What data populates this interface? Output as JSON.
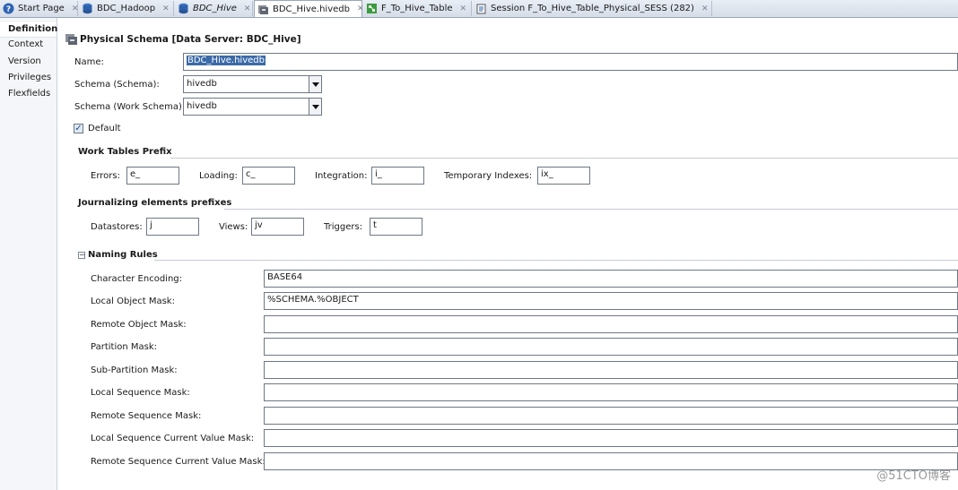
{
  "tabs": [
    {
      "label": "Start Page",
      "icon": "help-icon",
      "italic": false,
      "active": false
    },
    {
      "label": "BDC_Hadoop",
      "icon": "database-icon",
      "italic": false,
      "active": false
    },
    {
      "label": "BDC_Hive",
      "icon": "database-icon",
      "italic": true,
      "active": false
    },
    {
      "label": "BDC_Hive.hivedb",
      "icon": "physical-schema-icon",
      "italic": false,
      "active": true
    },
    {
      "label": "F_To_Hive_Table",
      "icon": "mapping-icon",
      "italic": false,
      "active": false
    },
    {
      "label": "Session F_To_Hive_Table_Physical_SESS (282)",
      "icon": "session-icon",
      "italic": false,
      "active": false
    }
  ],
  "nav": [
    {
      "label": "Definition",
      "selected": true
    },
    {
      "label": "Context",
      "selected": false
    },
    {
      "label": "Version",
      "selected": false
    },
    {
      "label": "Privileges",
      "selected": false
    },
    {
      "label": "Flexfields",
      "selected": false
    }
  ],
  "header": {
    "title": "Physical Schema [Data Server: BDC_Hive]"
  },
  "form": {
    "name_label": "Name:",
    "name_value": "BDC_Hive.hivedb",
    "schema_label": "Schema (Schema):",
    "schema_value": "hivedb",
    "work_schema_label": "Schema (Work Schema):",
    "work_schema_value": "hivedb",
    "default_label": "Default",
    "default_checked": true
  },
  "work_tables": {
    "section": "Work Tables Prefix",
    "errors_label": "Errors:",
    "errors_value": "e_",
    "loading_label": "Loading:",
    "loading_value": "c_",
    "integration_label": "Integration:",
    "integration_value": "i_",
    "temp_label": "Temporary Indexes:",
    "temp_value": "ix_"
  },
  "journalizing": {
    "section": "Journalizing elements prefixes",
    "datastores_label": "Datastores:",
    "datastores_value": "j",
    "views_label": "Views:",
    "views_value": "jv",
    "triggers_label": "Triggers:",
    "triggers_value": "t"
  },
  "naming": {
    "section": "Naming Rules",
    "rules": [
      {
        "label": "Character Encoding:",
        "value": "BASE64"
      },
      {
        "label": "Local Object Mask:",
        "value": "%SCHEMA.%OBJECT"
      },
      {
        "label": "Remote Object Mask:",
        "value": ""
      },
      {
        "label": "Partition Mask:",
        "value": ""
      },
      {
        "label": "Sub-Partition Mask:",
        "value": ""
      },
      {
        "label": "Local Sequence Mask:",
        "value": ""
      },
      {
        "label": "Remote Sequence Mask:",
        "value": ""
      },
      {
        "label": "Local Sequence Current Value Mask:",
        "value": ""
      },
      {
        "label": "Remote Sequence Current Value Mask:",
        "value": ""
      }
    ]
  },
  "watermark": "@51CTO博客"
}
